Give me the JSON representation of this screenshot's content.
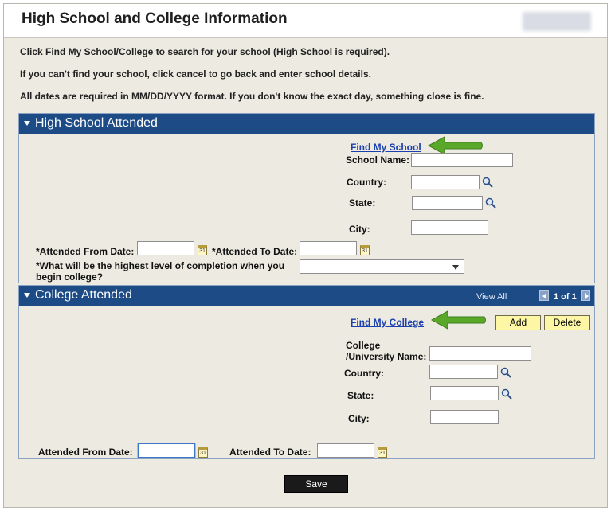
{
  "page": {
    "title": "High School and College Information",
    "instructions": [
      "Click Find My School/College to search for your school (High School is required).",
      "If you can't find your school, click cancel to go back and enter school details.",
      "All dates are required in MM/DD/YYYY format. If you don't know the exact day, something close is fine."
    ]
  },
  "high_school": {
    "header": "High School Attended",
    "find_link": "Find My School",
    "school_name_label": "School Name:",
    "country_label": "Country:",
    "state_label": "State:",
    "city_label": "City:",
    "from_date_label": "*Attended From Date:",
    "to_date_label": "*Attended To Date:",
    "completion_label": "*What will be the highest level of completion when you begin college?",
    "school_name_value": "",
    "country_value": "",
    "state_value": "",
    "city_value": "",
    "from_date_value": "",
    "to_date_value": "",
    "completion_value": ""
  },
  "college": {
    "header": "College Attended",
    "view_all": "View All",
    "pager": "1 of 1",
    "find_link": "Find My College",
    "add_label": "Add",
    "delete_label": "Delete",
    "name_label_line1": "College",
    "name_label_line2": "/University Name:",
    "country_label": "Country:",
    "state_label": "State:",
    "city_label": "City:",
    "from_date_label": "Attended From Date:",
    "to_date_label": "Attended To Date:",
    "name_value": "",
    "country_value": "",
    "state_value": "",
    "city_value": "",
    "from_date_value": "",
    "to_date_value": ""
  },
  "footer": {
    "save_label": "Save"
  },
  "icons": {
    "lookup": "magnifier-icon",
    "calendar": "calendar-icon",
    "annotation": "arrow-left-icon"
  },
  "colors": {
    "panel_header": "#1d4b86",
    "link": "#1b3fae",
    "annotation_arrow": "#5aa82a",
    "button_yellow": "#fdf6a5",
    "background": "#edebe1"
  }
}
